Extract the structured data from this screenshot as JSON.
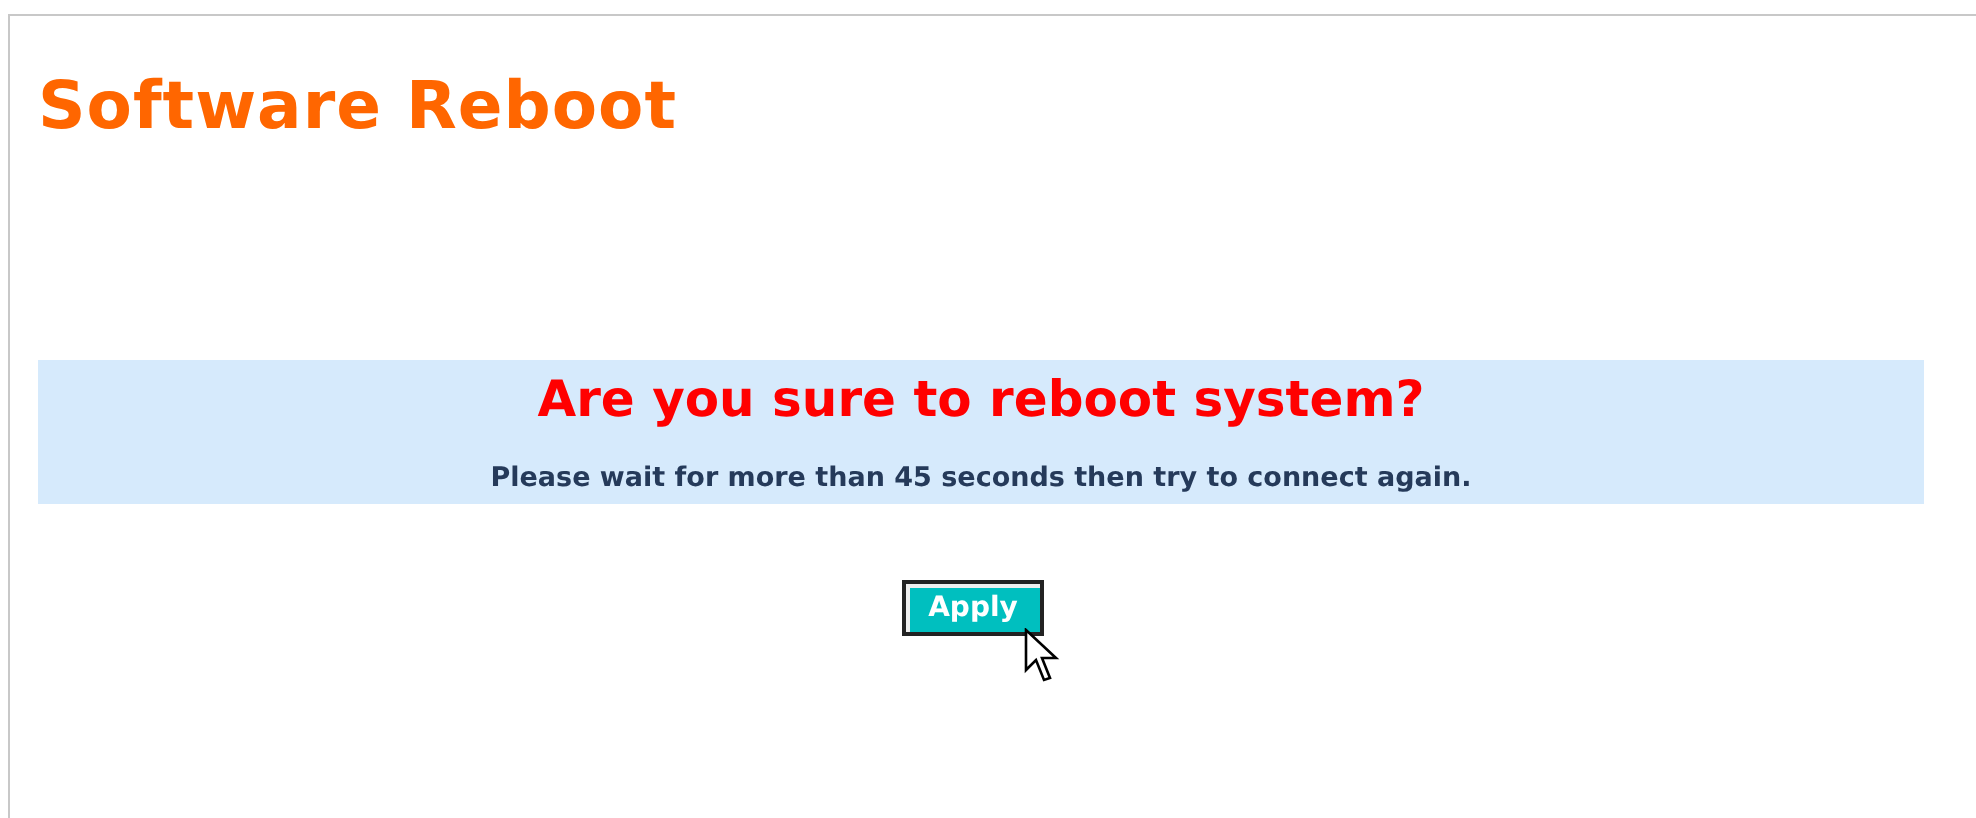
{
  "page_title": "Software Reboot",
  "confirm_panel": {
    "question": "Are you sure to reboot system?",
    "note": "Please wait for more than 45 seconds then try to connect again."
  },
  "buttons": [
    {
      "label": "Apply"
    }
  ]
}
